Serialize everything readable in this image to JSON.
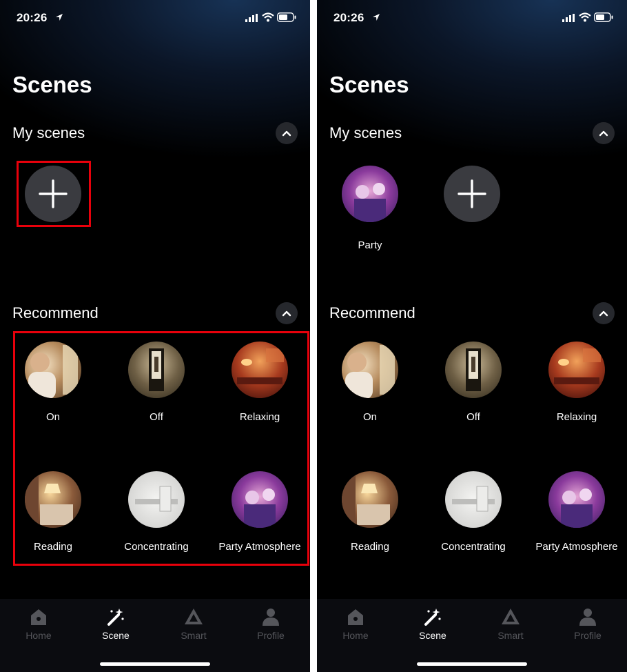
{
  "colors": {
    "highlight": "#e8000b",
    "active_tab": "#ffffff",
    "inactive_tab": "#55565b",
    "add_button_bg": "#3a3b40"
  },
  "screens": [
    {
      "status": {
        "time": "20:26"
      },
      "title": "Scenes",
      "my_scenes": {
        "title": "My scenes",
        "items": [],
        "add_icon": "plus-icon",
        "collapse_icon": "chevron-up-icon"
      },
      "recommend": {
        "title": "Recommend",
        "collapse_icon": "chevron-up-icon",
        "items": [
          {
            "label": "On"
          },
          {
            "label": "Off"
          },
          {
            "label": "Relaxing"
          },
          {
            "label": "Reading"
          },
          {
            "label": "Concentrating"
          },
          {
            "label": "Party Atmosphere"
          }
        ]
      },
      "tabs": [
        {
          "label": "Home",
          "icon": "home-icon",
          "active": false
        },
        {
          "label": "Scene",
          "icon": "magic-wand-icon",
          "active": true
        },
        {
          "label": "Smart",
          "icon": "smart-triangle-icon",
          "active": false
        },
        {
          "label": "Profile",
          "icon": "profile-icon",
          "active": false
        }
      ]
    },
    {
      "status": {
        "time": "20:26"
      },
      "title": "Scenes",
      "my_scenes": {
        "title": "My scenes",
        "items": [
          {
            "label": "Party"
          }
        ],
        "add_icon": "plus-icon",
        "collapse_icon": "chevron-up-icon"
      },
      "recommend": {
        "title": "Recommend",
        "collapse_icon": "chevron-up-icon",
        "items": [
          {
            "label": "On"
          },
          {
            "label": "Off"
          },
          {
            "label": "Relaxing"
          },
          {
            "label": "Reading"
          },
          {
            "label": "Concentrating"
          },
          {
            "label": "Party Atmosphere"
          }
        ]
      },
      "tabs": [
        {
          "label": "Home",
          "icon": "home-icon",
          "active": false
        },
        {
          "label": "Scene",
          "icon": "magic-wand-icon",
          "active": true
        },
        {
          "label": "Smart",
          "icon": "smart-triangle-icon",
          "active": false
        },
        {
          "label": "Profile",
          "icon": "profile-icon",
          "active": false
        }
      ]
    }
  ]
}
